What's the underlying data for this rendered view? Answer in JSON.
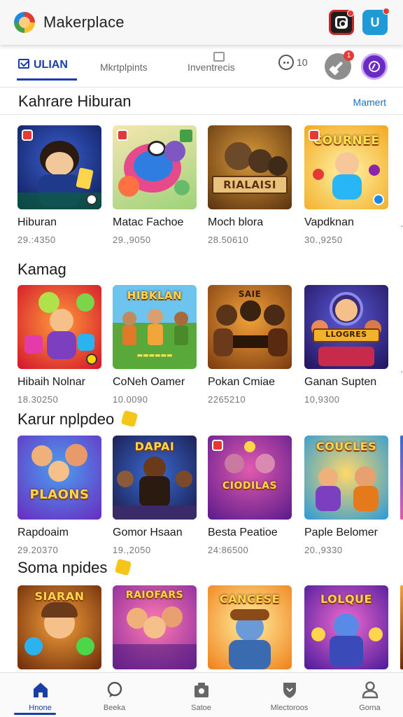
{
  "app": {
    "title": "Makerplace"
  },
  "tabs": [
    {
      "label": "ULIAN",
      "active": true
    },
    {
      "label": "Mkrtplpints",
      "active": false
    },
    {
      "label": "Inventrecis",
      "active": false
    }
  ],
  "counter": {
    "value": "10"
  },
  "notifications": {
    "badge": "1"
  },
  "section_header": {
    "title": "Kahrare  Hiburan",
    "see_all": "Mamert"
  },
  "sections": [
    {
      "title": "Hiburan",
      "cards": [
        {
          "title": "Hiburan",
          "sub": "29.:4350",
          "art_text": ""
        },
        {
          "title": "Matac Fachoe",
          "sub": "29.,9050",
          "art_text": ""
        },
        {
          "title": "Moch blora",
          "sub": "28.50610",
          "art_text": "RIALAISI"
        },
        {
          "title": "Vapdknan",
          "sub": "30.,9250",
          "art_text": "COURNEE"
        }
      ]
    },
    {
      "title": "Kamag",
      "cards": [
        {
          "title": "Hibaih Nolnar",
          "sub": "18.30250",
          "art_text": ""
        },
        {
          "title": "CoNeh Oamer",
          "sub": "10.0090",
          "art_text": "HIBKLAN"
        },
        {
          "title": "Pokan Cmiae",
          "sub": "2265210",
          "art_text": "SAIE"
        },
        {
          "title": "Ganan Supten",
          "sub": "10,9300",
          "art_text": "LLOGRES"
        }
      ]
    },
    {
      "title": "Karur nplpdeo",
      "cards": [
        {
          "title": "Rapdoaim",
          "sub": "29.20370",
          "art_text": "PLAONS"
        },
        {
          "title": "Gomor Hsaan",
          "sub": "19.,2050",
          "art_text": "DAPAI"
        },
        {
          "title": "Besta Peatioe",
          "sub": "24:86500",
          "art_text": "CIODILAS"
        },
        {
          "title": "Paple Belomer",
          "sub": "20.,9330",
          "art_text": "COUCLES"
        }
      ]
    },
    {
      "title": "Soma npides",
      "cards": [
        {
          "title": "",
          "sub": "",
          "art_text": "SIARAN"
        },
        {
          "title": "",
          "sub": "",
          "art_text": "RAIOFARS"
        },
        {
          "title": "",
          "sub": "",
          "art_text": "CANCESE"
        },
        {
          "title": "",
          "sub": "",
          "art_text": "LOLQUE"
        }
      ]
    }
  ],
  "bottom_nav": [
    {
      "label": "Hnone",
      "icon": "home-icon",
      "active": true
    },
    {
      "label": "Beeka",
      "icon": "chat-icon",
      "active": false
    },
    {
      "label": "Satoe",
      "icon": "store-icon",
      "active": false
    },
    {
      "label": "Mlectoroos",
      "icon": "shield-icon",
      "active": false
    },
    {
      "label": "Gorna",
      "icon": "person-icon",
      "active": false
    }
  ],
  "colors": {
    "accent": "#1a3ea5",
    "link": "#1a73c9"
  }
}
